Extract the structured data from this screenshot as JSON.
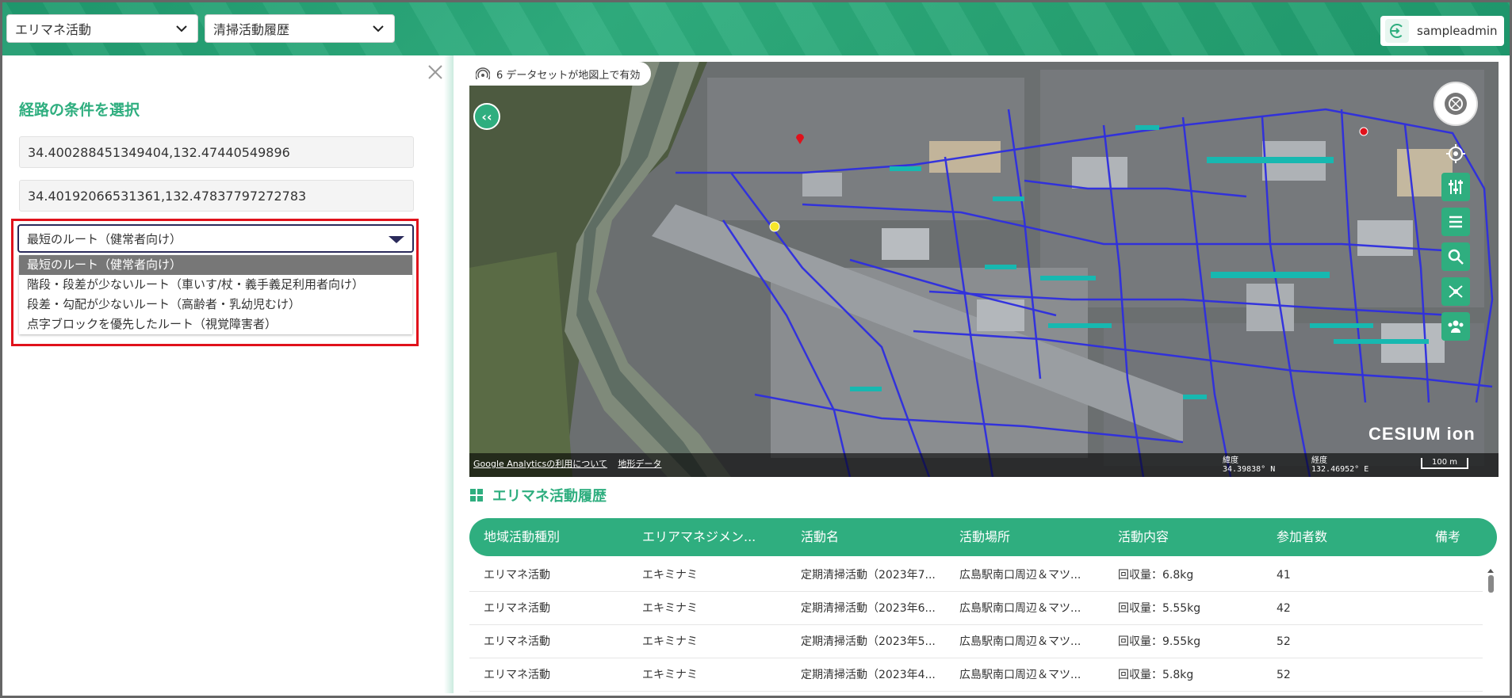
{
  "header": {
    "select_1": "エリマネ活動",
    "select_2": "清掃活動履歴",
    "user_name": "sampleadmin"
  },
  "panel": {
    "title": "経路の条件を選択",
    "start_coord": "34.400288451349404,132.47440549896",
    "end_coord": "34.40192066531361,132.47837797272783",
    "route_selected": "最短のルート（健常者向け）",
    "route_options": [
      "最短のルート（健常者向け）",
      "階段・段差が少ないルート（車いす/杖・義手義足利用者向け）",
      "段差・勾配が少ないルート（高齢者・乳幼児むけ）",
      "点字ブロックを優先したルート（視覚障害者）"
    ]
  },
  "map": {
    "dataset_status": "6 データセットが地図上で有効",
    "credit_analytics": "Google Analyticsの利用について",
    "credit_terrain": "地形データ",
    "lat_label": "緯度",
    "lat_value": "34.39838° N",
    "lng_label": "経度",
    "lng_value": "132.46952° E",
    "scale": "100 m",
    "logo": "CESIUM ion"
  },
  "history": {
    "title": "エリマネ活動履歴",
    "columns": [
      "地域活動種別",
      "エリアマネジメン...",
      "活動名",
      "活動場所",
      "活動内容",
      "参加者数",
      "備考"
    ],
    "rows": [
      [
        "エリマネ活動",
        "エキミナミ",
        "定期清掃活動（2023年7...",
        "広島駅南口周辺＆マツ...",
        "回収量：6.8kg",
        "41",
        ""
      ],
      [
        "エリマネ活動",
        "エキミナミ",
        "定期清掃活動（2023年6...",
        "広島駅南口周辺＆マツ...",
        "回収量：5.55kg",
        "42",
        ""
      ],
      [
        "エリマネ活動",
        "エキミナミ",
        "定期清掃活動（2023年5...",
        "広島駅南口周辺＆マツ...",
        "回収量：9.55kg",
        "52",
        ""
      ],
      [
        "エリマネ活動",
        "エキミナミ",
        "定期清掃活動（2023年4...",
        "広島駅南口周辺＆マツ...",
        "回収量：5.8kg",
        "52",
        ""
      ]
    ]
  },
  "colors": {
    "accent": "#2fae7f",
    "highlight": "#e0111b",
    "route_line": "#2e2ee0"
  }
}
